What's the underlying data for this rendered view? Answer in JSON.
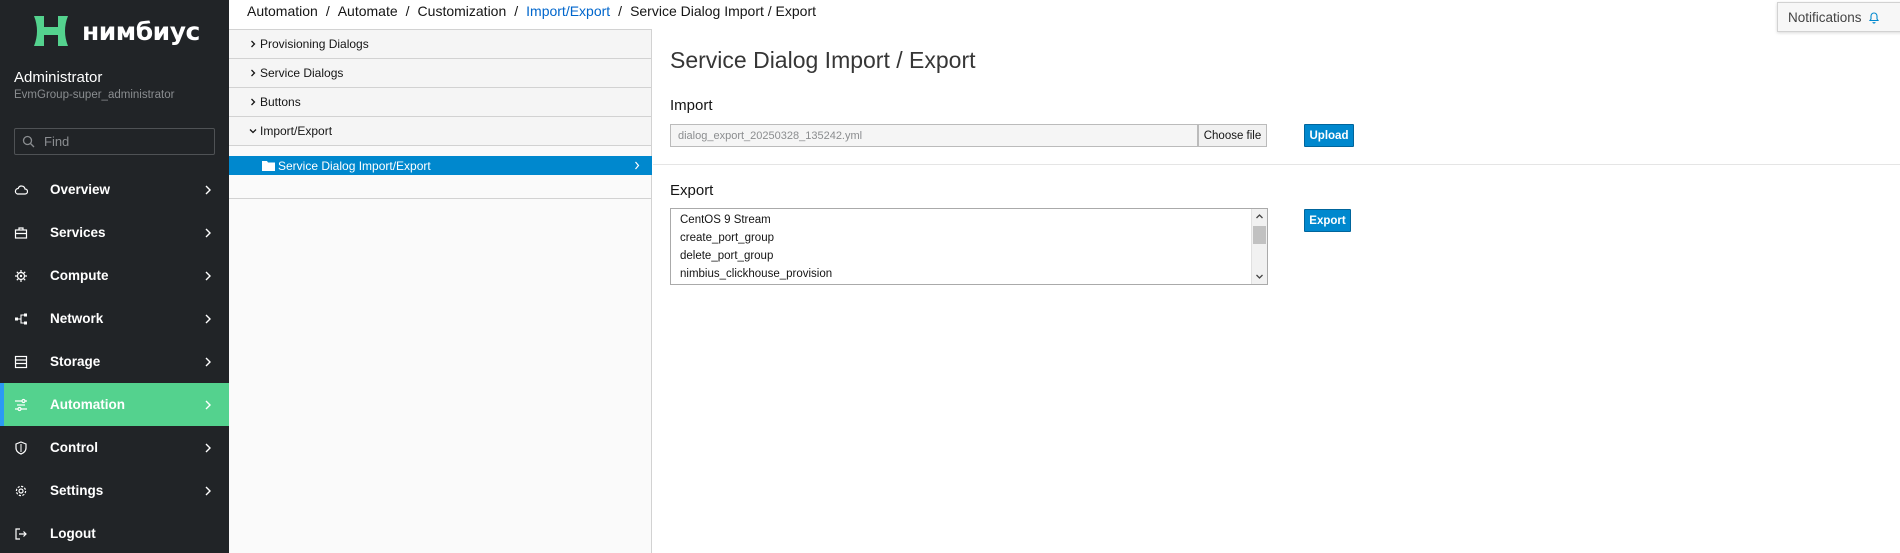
{
  "brand": {
    "name": "нимбиус",
    "accent": "#54d28e"
  },
  "user": {
    "name": "Administrator",
    "group": "EvmGroup-super_administrator"
  },
  "search": {
    "placeholder": "Find"
  },
  "nav": [
    {
      "label": "Overview",
      "icon": "cloud-icon"
    },
    {
      "label": "Services",
      "icon": "briefcase-icon"
    },
    {
      "label": "Compute",
      "icon": "cpu-icon"
    },
    {
      "label": "Network",
      "icon": "network-icon"
    },
    {
      "label": "Storage",
      "icon": "database-icon"
    },
    {
      "label": "Automation",
      "icon": "automation-icon",
      "active": true
    },
    {
      "label": "Control",
      "icon": "shield-icon"
    },
    {
      "label": "Settings",
      "icon": "gear-icon"
    },
    {
      "label": "Logout",
      "icon": "logout-icon"
    }
  ],
  "breadcrumb": [
    "Automation",
    "Automate",
    "Customization",
    "Import/Export",
    "Service Dialog Import / Export"
  ],
  "notifications": {
    "label": "Notifications"
  },
  "tree": {
    "sections": [
      {
        "label": "Provisioning Dialogs",
        "expanded": false
      },
      {
        "label": "Service Dialogs",
        "expanded": false
      },
      {
        "label": "Buttons",
        "expanded": false
      },
      {
        "label": "Import/Export",
        "expanded": true
      }
    ],
    "selected_node": "Service Dialog Import/Export"
  },
  "main": {
    "title": "Service Dialog Import / Export",
    "import": {
      "label": "Import",
      "file_name": "dialog_export_20250328_135242.yml",
      "choose_label": "Choose file",
      "upload_label": "Upload"
    },
    "export": {
      "label": "Export",
      "options": [
        "CentOS 9 Stream",
        "create_port_group",
        "delete_port_group",
        "nimbius_clickhouse_provision"
      ],
      "export_label": "Export"
    }
  }
}
